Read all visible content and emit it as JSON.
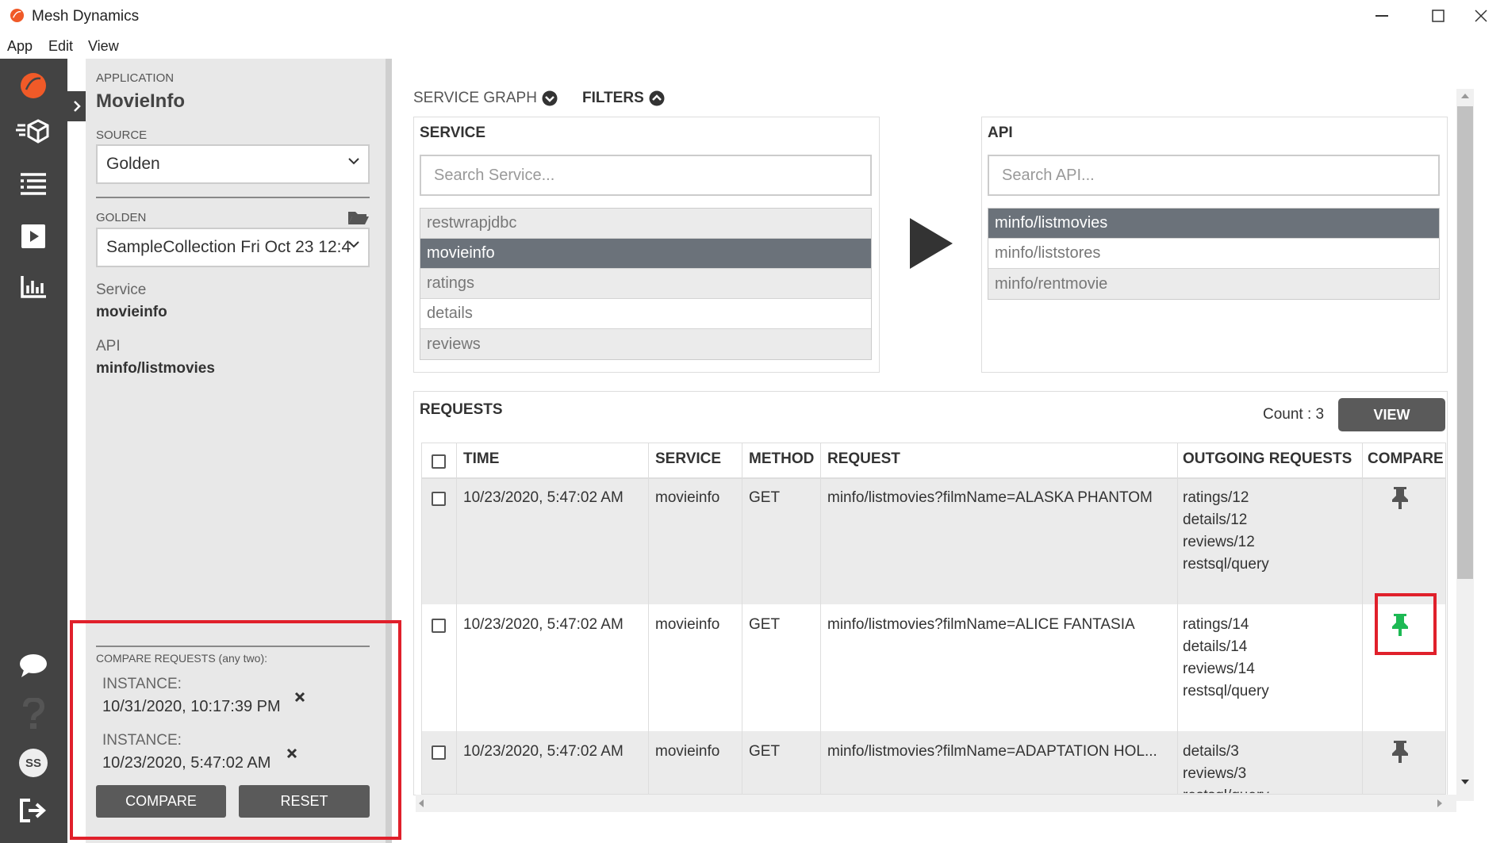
{
  "window": {
    "title": "Mesh Dynamics"
  },
  "menu": [
    "App",
    "Edit",
    "View"
  ],
  "rail": {
    "icons": [
      "app-logo-icon",
      "cube-icon",
      "list-icon",
      "play-icon",
      "chart-icon",
      "chat-icon",
      "help-icon",
      "avatar",
      "logout-icon"
    ],
    "avatar_initials": "SS"
  },
  "left": {
    "application_label": "APPLICATION",
    "application_name": "MovieInfo",
    "source_label": "SOURCE",
    "source_value": "Golden",
    "golden_label": "GOLDEN",
    "golden_value": "SampleCollection Fri Oct 23 12:4",
    "service_label": "Service",
    "service_value": "movieinfo",
    "api_label": "API",
    "api_value": "minfo/listmovies",
    "compare_title": "COMPARE REQUESTS (any two):",
    "instances": [
      {
        "label": "INSTANCE:",
        "value": "10/31/2020, 10:17:39 PM"
      },
      {
        "label": "INSTANCE:",
        "value": "10/23/2020, 5:47:02 AM"
      }
    ],
    "compare_button": "COMPARE",
    "reset_button": "RESET"
  },
  "tabs": {
    "service_graph": "SERVICE GRAPH",
    "filters": "FILTERS"
  },
  "service": {
    "title": "SERVICE",
    "placeholder": "Search Service...",
    "items": [
      "restwrapjdbc",
      "movieinfo",
      "ratings",
      "details",
      "reviews"
    ],
    "selected": "movieinfo"
  },
  "api": {
    "title": "API",
    "placeholder": "Search API...",
    "items": [
      "minfo/listmovies",
      "minfo/liststores",
      "minfo/rentmovie"
    ],
    "selected": "minfo/listmovies"
  },
  "requests": {
    "title": "REQUESTS",
    "count": "Count : 3",
    "view_button": "VIEW",
    "columns": [
      "TIME",
      "SERVICE",
      "METHOD",
      "REQUEST",
      "OUTGOING REQUESTS",
      "COMPARE"
    ],
    "rows": [
      {
        "time": "10/23/2020, 5:47:02 AM",
        "service": "movieinfo",
        "method": "GET",
        "request": "minfo/listmovies?filmName=ALASKA PHANTOM",
        "outgoing": [
          "ratings/12",
          "details/12",
          "reviews/12",
          "restsql/query"
        ],
        "pinned": false
      },
      {
        "time": "10/23/2020, 5:47:02 AM",
        "service": "movieinfo",
        "method": "GET",
        "request": "minfo/listmovies?filmName=ALICE FANTASIA",
        "outgoing": [
          "ratings/14",
          "details/14",
          "reviews/14",
          "restsql/query"
        ],
        "pinned": true
      },
      {
        "time": "10/23/2020, 5:47:02 AM",
        "service": "movieinfo",
        "method": "GET",
        "request": "minfo/listmovies?filmName=ADAPTATION HOL...",
        "outgoing": [
          "details/3",
          "reviews/3",
          "restsql/query"
        ],
        "pinned": false
      }
    ]
  },
  "colors": {
    "accent_red": "#e0202b",
    "pin_active": "#1db954",
    "rail_bg": "#434343",
    "logo": "#f05a28"
  }
}
